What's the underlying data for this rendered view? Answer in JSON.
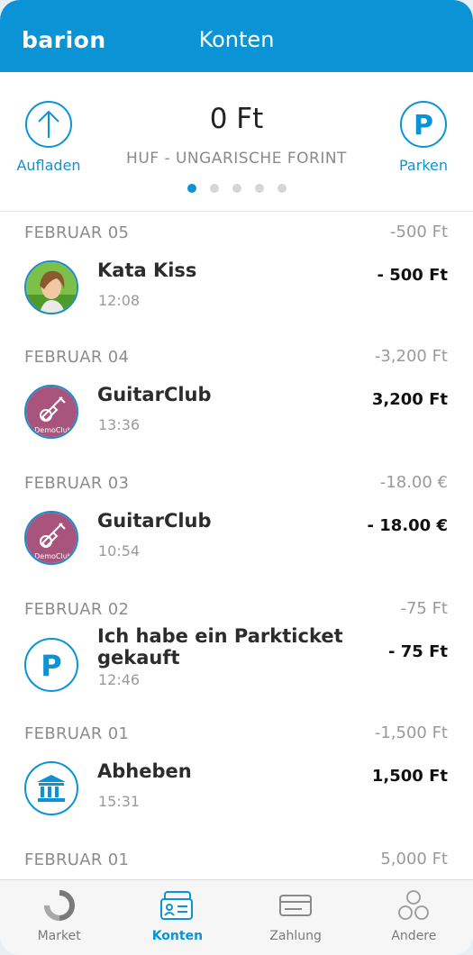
{
  "header": {
    "logo": "barion",
    "title": "Konten",
    "brand_color": "#0a94d6"
  },
  "balance": {
    "top_up_label": "Aufladen",
    "amount": "0 Ft",
    "currency": "HUF - UNGARISCHE FORINT",
    "parking_label": "Parken",
    "pager": {
      "count": 5,
      "active": 1
    }
  },
  "transactions": [
    {
      "date": "FEBRUAR 05",
      "day_total": "-500 Ft",
      "name": "Kata Kiss",
      "time": "12:08",
      "amount": "- 500 Ft",
      "icon": "user-photo"
    },
    {
      "date": "FEBRUAR 04",
      "day_total": "-3,200 Ft",
      "name": "GuitarClub",
      "time": "13:36",
      "amount": "3,200 Ft",
      "icon": "guitar-club-logo",
      "logo_text": "DemoClub"
    },
    {
      "date": "FEBRUAR 03",
      "day_total": "-18.00 €",
      "name": "GuitarClub",
      "time": "10:54",
      "amount": "- 18.00 €",
      "icon": "guitar-club-logo",
      "logo_text": "DemoClub"
    },
    {
      "date": "FEBRUAR 02",
      "day_total": "-75 Ft",
      "name": "Ich habe ein Parkticket gekauft",
      "time": "12:46",
      "amount": "- 75 Ft",
      "icon": "parking-icon"
    },
    {
      "date": "FEBRUAR 01",
      "day_total": "-1,500 Ft",
      "name": "Abheben",
      "time": "15:31",
      "amount": "1,500 Ft",
      "icon": "bank-icon"
    },
    {
      "date": "FEBRUAR 01",
      "day_total": "5,000 Ft"
    }
  ],
  "bottom_nav": {
    "items": [
      {
        "label": "Market",
        "icon": "market-icon",
        "active": false
      },
      {
        "label": "Konten",
        "icon": "accounts-icon",
        "active": true
      },
      {
        "label": "Zahlung",
        "icon": "card-icon",
        "active": false
      },
      {
        "label": "Andere",
        "icon": "more-icon",
        "active": false
      }
    ]
  }
}
